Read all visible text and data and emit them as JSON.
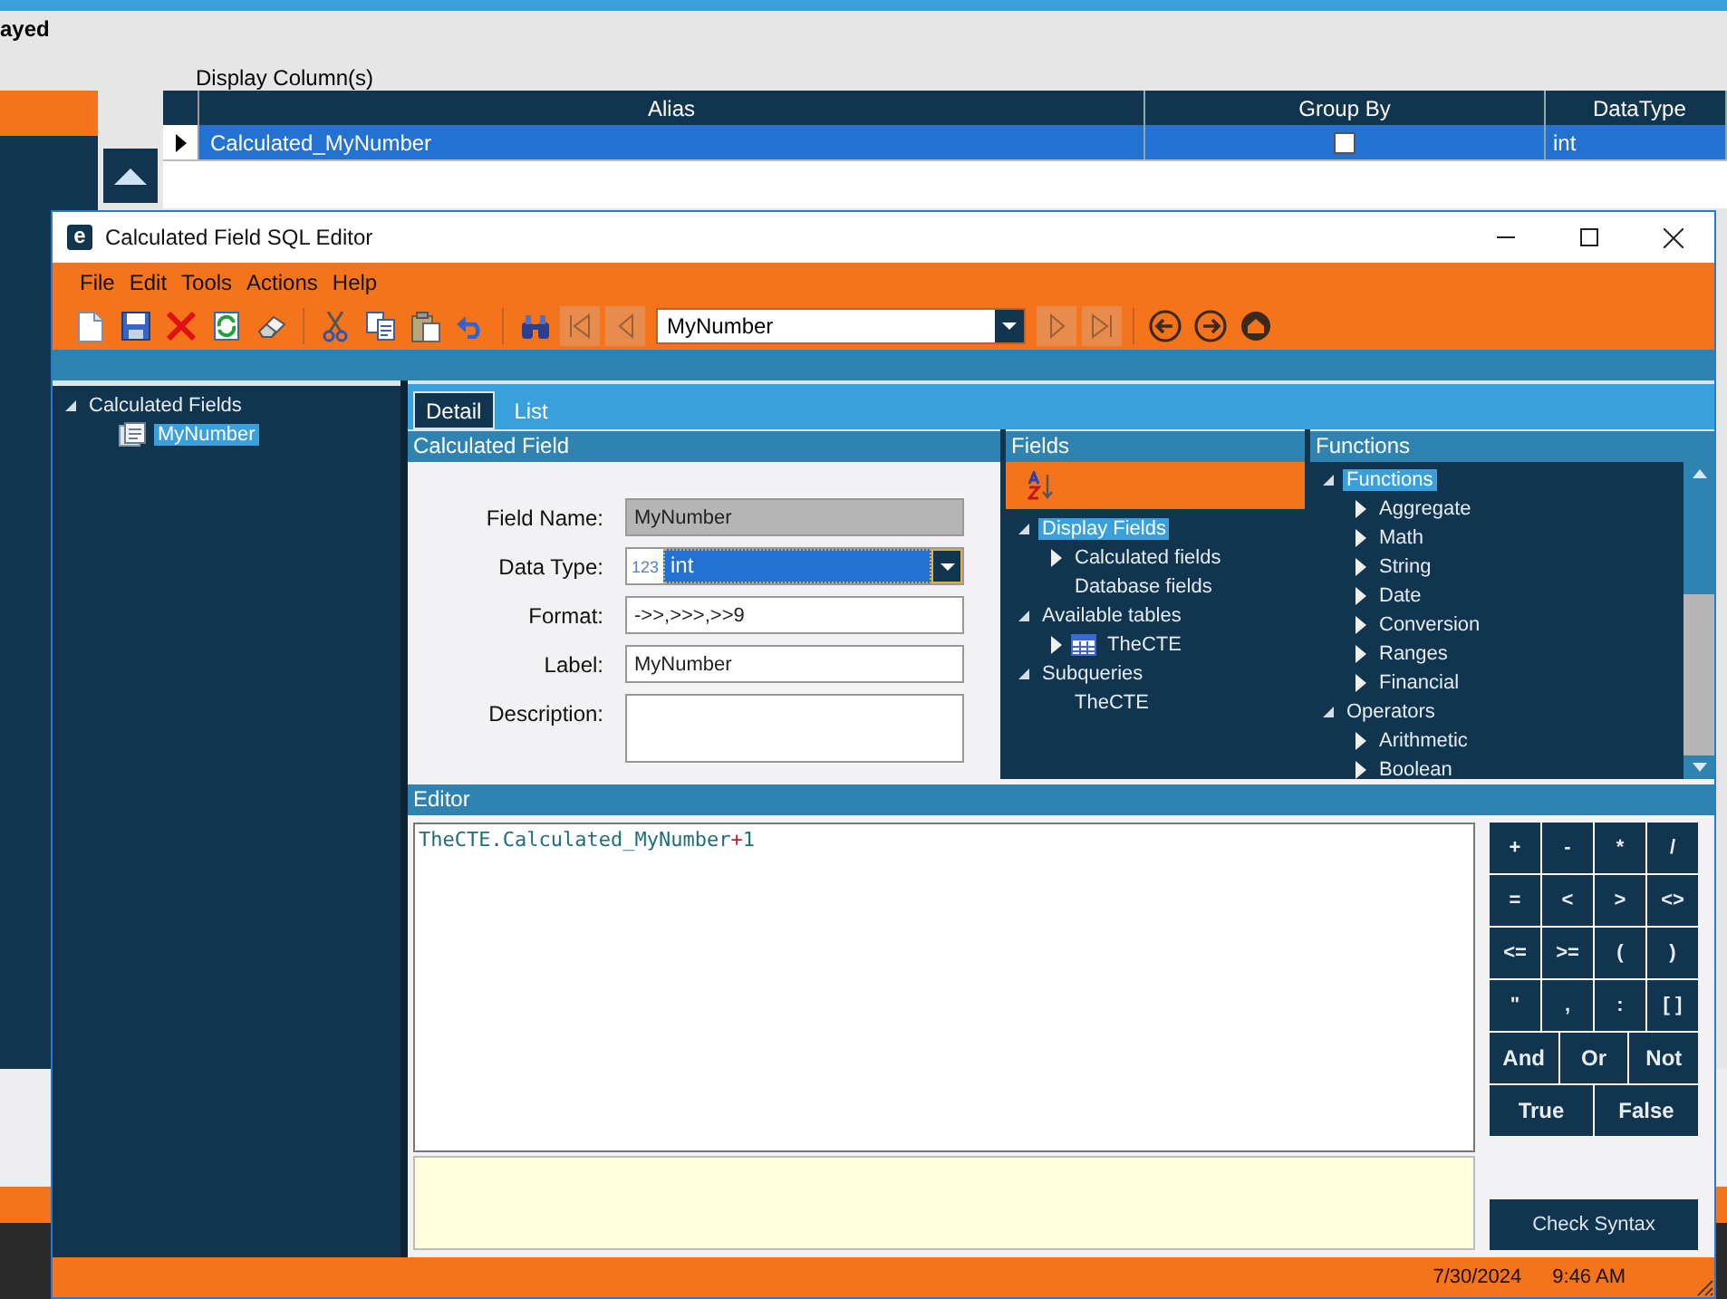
{
  "background": {
    "heading": "ayed",
    "display_label": "Display Column(s)",
    "table": {
      "columns": [
        "Alias",
        "Group By",
        "DataType"
      ],
      "rows": [
        {
          "alias": "Calculated_MyNumber",
          "group_by": false,
          "datatype": "int",
          "selected": true
        }
      ]
    }
  },
  "dialog": {
    "logo_letter": "e",
    "title": "Calculated Field SQL Editor",
    "menu": [
      "File",
      "Edit",
      "Tools",
      "Actions",
      "Help"
    ],
    "toolbar": [
      {
        "kind": "new"
      },
      {
        "kind": "save"
      },
      {
        "kind": "delete"
      },
      {
        "kind": "refresh"
      },
      {
        "kind": "eraser"
      },
      {
        "kind": "separator"
      },
      {
        "kind": "cut"
      },
      {
        "kind": "copy"
      },
      {
        "kind": "paste"
      },
      {
        "kind": "undo"
      },
      {
        "kind": "separator"
      },
      {
        "kind": "find"
      },
      {
        "kind": "first",
        "disabled": true
      },
      {
        "kind": "prev",
        "disabled": true
      },
      {
        "kind": "combo"
      },
      {
        "kind": "next",
        "disabled": true
      },
      {
        "kind": "last",
        "disabled": true
      },
      {
        "kind": "separator"
      },
      {
        "kind": "back"
      },
      {
        "kind": "forward"
      },
      {
        "kind": "home"
      }
    ],
    "record_combo": "MyNumber",
    "tree": [
      {
        "label": "Calculated Fields",
        "kind": "folder",
        "expanded": true,
        "selected": false,
        "children": [
          {
            "label": "MyNumber",
            "kind": "field",
            "selected": true
          }
        ]
      }
    ],
    "tabs": [
      {
        "label": "Detail",
        "selected": true
      },
      {
        "label": "List",
        "selected": false
      }
    ],
    "calculated_field": {
      "header": "Calculated Field",
      "fields": [
        {
          "label": "Field Name:",
          "kind": "readonly",
          "value": "MyNumber"
        },
        {
          "label": "Data Type:",
          "kind": "combo",
          "badge": "123",
          "value": "int"
        },
        {
          "label": "Format:",
          "kind": "text",
          "value": "->>,>>>,>>9"
        },
        {
          "label": "Label:",
          "kind": "text",
          "value": "MyNumber"
        },
        {
          "label": "Description:",
          "kind": "textarea"
        }
      ]
    },
    "fields_panel": {
      "header": "Fields",
      "tree": [
        {
          "label": "Display Fields",
          "kind": "folder",
          "expanded": true,
          "selected": true,
          "children": [
            {
              "label": "Calculated fields",
              "kind": "folder",
              "expanded": false,
              "selected": false
            },
            {
              "label": "Database fields",
              "kind": "item",
              "selected": false
            }
          ]
        },
        {
          "label": "Available tables",
          "kind": "folder",
          "expanded": true,
          "selected": false,
          "children": [
            {
              "label": "TheCTE",
              "kind": "table",
              "expanded": false,
              "selected": false
            }
          ]
        },
        {
          "label": "Subqueries",
          "kind": "folder",
          "expanded": true,
          "selected": false,
          "children": [
            {
              "label": "TheCTE",
              "kind": "item",
              "selected": false
            }
          ]
        }
      ]
    },
    "functions_panel": {
      "header": "Functions",
      "tree": [
        {
          "label": "Functions",
          "kind": "folder",
          "expanded": true,
          "selected": true,
          "children": [
            {
              "label": "Aggregate",
              "kind": "folder",
              "expanded": false,
              "selected": false
            },
            {
              "label": "Math",
              "kind": "folder",
              "expanded": false,
              "selected": false
            },
            {
              "label": "String",
              "kind": "folder",
              "expanded": false,
              "selected": false
            },
            {
              "label": "Date",
              "kind": "folder",
              "expanded": false,
              "selected": false
            },
            {
              "label": "Conversion",
              "kind": "folder",
              "expanded": false,
              "selected": false
            },
            {
              "label": "Ranges",
              "kind": "folder",
              "expanded": false,
              "selected": false
            },
            {
              "label": "Financial",
              "kind": "folder",
              "expanded": false,
              "selected": false
            }
          ]
        },
        {
          "label": "Operators",
          "kind": "folder",
          "expanded": true,
          "selected": false,
          "children": [
            {
              "label": "Arithmetic",
              "kind": "folder",
              "expanded": false,
              "selected": false
            },
            {
              "label": "Boolean",
              "kind": "folder",
              "expanded": false,
              "selected": false
            }
          ]
        }
      ]
    },
    "editor": {
      "header": "Editor",
      "code": [
        {
          "text": "TheCTE.Calculated_MyNumber",
          "kind": "identifier"
        },
        {
          "text": "+",
          "kind": "operator"
        },
        {
          "text": "1",
          "kind": "number"
        }
      ]
    },
    "keypad": [
      [
        "+",
        "-",
        "*",
        "/"
      ],
      [
        "=",
        "<",
        ">",
        "<>"
      ],
      [
        "<=",
        ">=",
        "(",
        ")"
      ],
      [
        "\"",
        ",",
        ":",
        "[ ]"
      ],
      [
        "And",
        "Or",
        "Not"
      ],
      [
        "True",
        "False"
      ]
    ],
    "check_syntax": "Check Syntax",
    "status": {
      "date": "7/30/2024",
      "time": "9:46 AM"
    }
  }
}
